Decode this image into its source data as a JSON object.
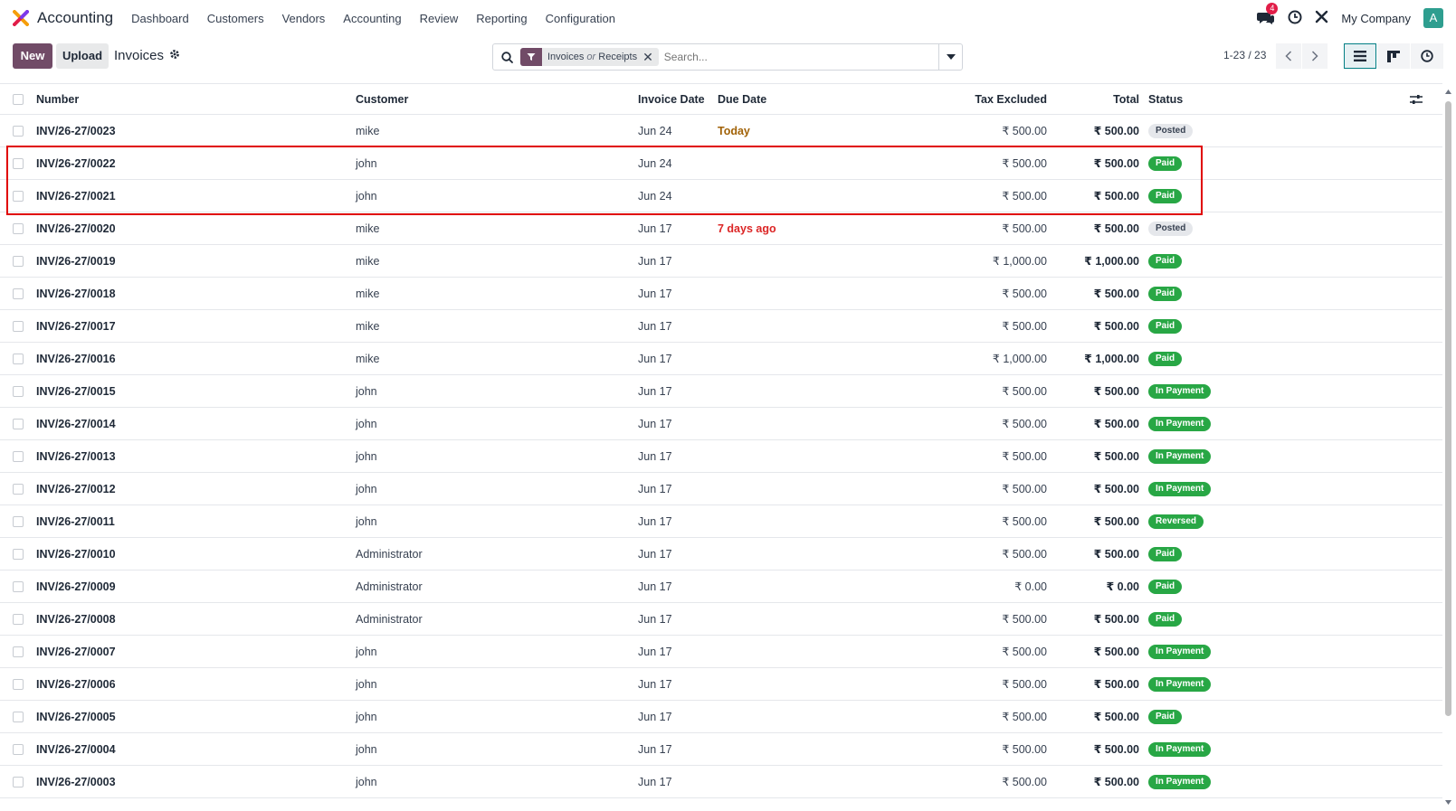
{
  "navbar": {
    "app_name": "Accounting",
    "menu": [
      "Dashboard",
      "Customers",
      "Vendors",
      "Accounting",
      "Review",
      "Reporting",
      "Configuration"
    ],
    "chat_count": "4",
    "company": "My Company",
    "avatar_letter": "A"
  },
  "control": {
    "new_label": "New",
    "upload_label": "Upload",
    "breadcrumb": "Invoices",
    "facet_a": "Invoices",
    "facet_or": "or",
    "facet_b": "Receipts",
    "search_placeholder": "Search...",
    "pager": "1-23 / 23"
  },
  "table": {
    "headers": {
      "number": "Number",
      "customer": "Customer",
      "invoice_date": "Invoice Date",
      "due_date": "Due Date",
      "tax_excluded": "Tax Excluded",
      "total": "Total",
      "status": "Status"
    },
    "rows": [
      {
        "number": "INV/26-27/0023",
        "customer": "mike",
        "invoice_date": "Jun 24",
        "due": "Today",
        "due_style": "warn",
        "tax": "₹ 500.00",
        "total": "₹ 500.00",
        "status": "Posted",
        "status_style": "secondary"
      },
      {
        "number": "INV/26-27/0022",
        "customer": "john",
        "invoice_date": "Jun 24",
        "due": "",
        "due_style": "",
        "tax": "₹ 500.00",
        "total": "₹ 500.00",
        "status": "Paid",
        "status_style": "success"
      },
      {
        "number": "INV/26-27/0021",
        "customer": "john",
        "invoice_date": "Jun 24",
        "due": "",
        "due_style": "",
        "tax": "₹ 500.00",
        "total": "₹ 500.00",
        "status": "Paid",
        "status_style": "success"
      },
      {
        "number": "INV/26-27/0020",
        "customer": "mike",
        "invoice_date": "Jun 17",
        "due": "7 days ago",
        "due_style": "danger",
        "tax": "₹ 500.00",
        "total": "₹ 500.00",
        "status": "Posted",
        "status_style": "secondary"
      },
      {
        "number": "INV/26-27/0019",
        "customer": "mike",
        "invoice_date": "Jun 17",
        "due": "",
        "due_style": "",
        "tax": "₹ 1,000.00",
        "total": "₹ 1,000.00",
        "status": "Paid",
        "status_style": "success"
      },
      {
        "number": "INV/26-27/0018",
        "customer": "mike",
        "invoice_date": "Jun 17",
        "due": "",
        "due_style": "",
        "tax": "₹ 500.00",
        "total": "₹ 500.00",
        "status": "Paid",
        "status_style": "success"
      },
      {
        "number": "INV/26-27/0017",
        "customer": "mike",
        "invoice_date": "Jun 17",
        "due": "",
        "due_style": "",
        "tax": "₹ 500.00",
        "total": "₹ 500.00",
        "status": "Paid",
        "status_style": "success"
      },
      {
        "number": "INV/26-27/0016",
        "customer": "mike",
        "invoice_date": "Jun 17",
        "due": "",
        "due_style": "",
        "tax": "₹ 1,000.00",
        "total": "₹ 1,000.00",
        "status": "Paid",
        "status_style": "success"
      },
      {
        "number": "INV/26-27/0015",
        "customer": "john",
        "invoice_date": "Jun 17",
        "due": "",
        "due_style": "",
        "tax": "₹ 500.00",
        "total": "₹ 500.00",
        "status": "In Payment",
        "status_style": "success"
      },
      {
        "number": "INV/26-27/0014",
        "customer": "john",
        "invoice_date": "Jun 17",
        "due": "",
        "due_style": "",
        "tax": "₹ 500.00",
        "total": "₹ 500.00",
        "status": "In Payment",
        "status_style": "success"
      },
      {
        "number": "INV/26-27/0013",
        "customer": "john",
        "invoice_date": "Jun 17",
        "due": "",
        "due_style": "",
        "tax": "₹ 500.00",
        "total": "₹ 500.00",
        "status": "In Payment",
        "status_style": "success"
      },
      {
        "number": "INV/26-27/0012",
        "customer": "john",
        "invoice_date": "Jun 17",
        "due": "",
        "due_style": "",
        "tax": "₹ 500.00",
        "total": "₹ 500.00",
        "status": "In Payment",
        "status_style": "success"
      },
      {
        "number": "INV/26-27/0011",
        "customer": "john",
        "invoice_date": "Jun 17",
        "due": "",
        "due_style": "",
        "tax": "₹ 500.00",
        "total": "₹ 500.00",
        "status": "Reversed",
        "status_style": "success"
      },
      {
        "number": "INV/26-27/0010",
        "customer": "Administrator",
        "invoice_date": "Jun 17",
        "due": "",
        "due_style": "",
        "tax": "₹ 500.00",
        "total": "₹ 500.00",
        "status": "Paid",
        "status_style": "success"
      },
      {
        "number": "INV/26-27/0009",
        "customer": "Administrator",
        "invoice_date": "Jun 17",
        "due": "",
        "due_style": "",
        "tax": "₹ 0.00",
        "total": "₹ 0.00",
        "status": "Paid",
        "status_style": "success"
      },
      {
        "number": "INV/26-27/0008",
        "customer": "Administrator",
        "invoice_date": "Jun 17",
        "due": "",
        "due_style": "",
        "tax": "₹ 500.00",
        "total": "₹ 500.00",
        "status": "Paid",
        "status_style": "success"
      },
      {
        "number": "INV/26-27/0007",
        "customer": "john",
        "invoice_date": "Jun 17",
        "due": "",
        "due_style": "",
        "tax": "₹ 500.00",
        "total": "₹ 500.00",
        "status": "In Payment",
        "status_style": "success"
      },
      {
        "number": "INV/26-27/0006",
        "customer": "john",
        "invoice_date": "Jun 17",
        "due": "",
        "due_style": "",
        "tax": "₹ 500.00",
        "total": "₹ 500.00",
        "status": "In Payment",
        "status_style": "success"
      },
      {
        "number": "INV/26-27/0005",
        "customer": "john",
        "invoice_date": "Jun 17",
        "due": "",
        "due_style": "",
        "tax": "₹ 500.00",
        "total": "₹ 500.00",
        "status": "Paid",
        "status_style": "success"
      },
      {
        "number": "INV/26-27/0004",
        "customer": "john",
        "invoice_date": "Jun 17",
        "due": "",
        "due_style": "",
        "tax": "₹ 500.00",
        "total": "₹ 500.00",
        "status": "In Payment",
        "status_style": "success"
      },
      {
        "number": "INV/26-27/0003",
        "customer": "john",
        "invoice_date": "Jun 17",
        "due": "",
        "due_style": "",
        "tax": "₹ 500.00",
        "total": "₹ 500.00",
        "status": "In Payment",
        "status_style": "success"
      }
    ]
  },
  "colors": {
    "brand": "#714b67",
    "success": "#28a745",
    "danger": "#dc2626",
    "warning": "#a16207",
    "highlight": "#e00000"
  },
  "icons": [
    "app-logo-icon",
    "chat-icon",
    "clock-icon",
    "tools-icon",
    "gear-icon",
    "search-icon",
    "filter-icon",
    "close-icon",
    "caret-down-icon",
    "chevron-left-icon",
    "chevron-right-icon",
    "list-view-icon",
    "kanban-view-icon",
    "activity-view-icon",
    "optional-columns-icon"
  ]
}
